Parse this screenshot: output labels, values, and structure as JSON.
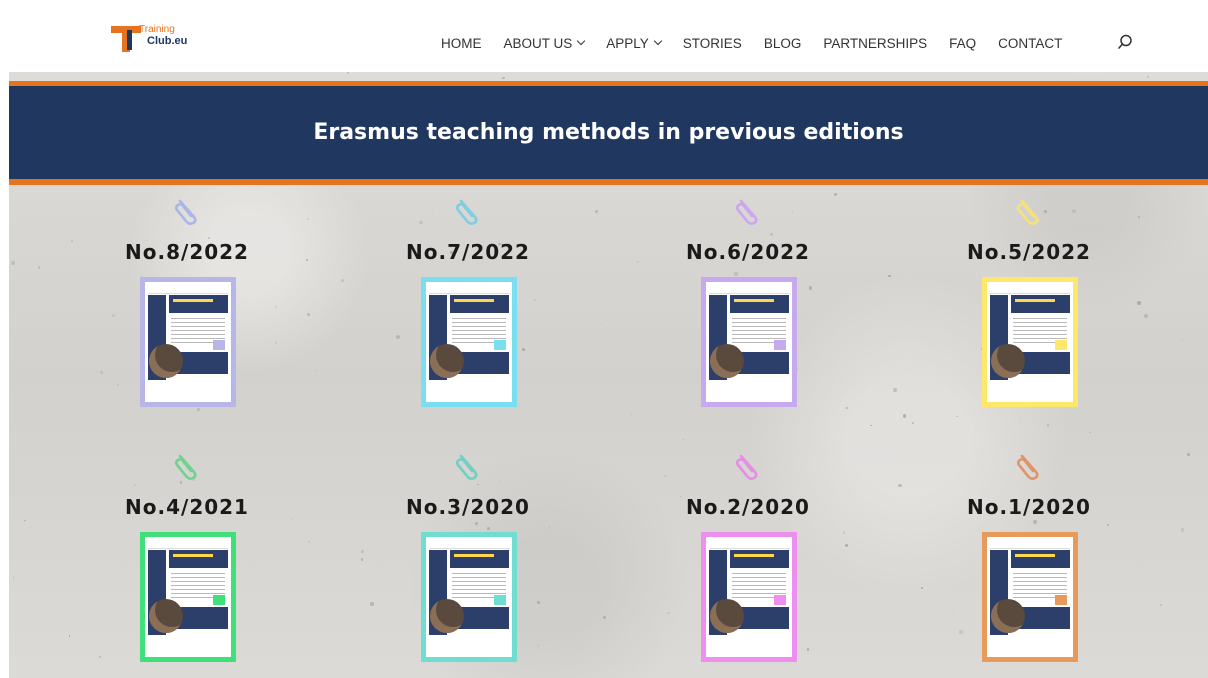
{
  "header": {
    "logo": {
      "line1": "Training",
      "line2": "Club.eu"
    },
    "nav": [
      {
        "label": "HOME",
        "has_dropdown": false
      },
      {
        "label": "ABOUT US",
        "has_dropdown": true
      },
      {
        "label": "APPLY",
        "has_dropdown": true
      },
      {
        "label": "STORIES",
        "has_dropdown": false
      },
      {
        "label": "BLOG",
        "has_dropdown": false
      },
      {
        "label": "PARTNERSHIPS",
        "has_dropdown": false
      },
      {
        "label": "FAQ",
        "has_dropdown": false
      },
      {
        "label": "CONTACT",
        "has_dropdown": false
      }
    ],
    "search_icon": "search-icon"
  },
  "banner": {
    "title": "Erasmus teaching methods in previous editions"
  },
  "issues": [
    {
      "label": "No.8/2022",
      "color": "#b8b6e6",
      "clip_color": "#a9b6e6"
    },
    {
      "label": "No.7/2022",
      "color": "#79dff0",
      "clip_color": "#7fcde0"
    },
    {
      "label": "No.6/2022",
      "color": "#c7a9ee",
      "clip_color": "#c9a8ef"
    },
    {
      "label": "No.5/2022",
      "color": "#fde86b",
      "clip_color": "#f5e27c"
    },
    {
      "label": "No.4/2021",
      "color": "#3fe07a",
      "clip_color": "#6fd38f"
    },
    {
      "label": "No.3/2020",
      "color": "#6fddd0",
      "clip_color": "#72cfc3"
    },
    {
      "label": "No.2/2020",
      "color": "#ee8ff0",
      "clip_color": "#e58ee6"
    },
    {
      "label": "No.1/2020",
      "color": "#e89a5a",
      "clip_color": "#e0946a"
    }
  ],
  "colors": {
    "banner": "#20375f",
    "accent": "#e8731e"
  }
}
